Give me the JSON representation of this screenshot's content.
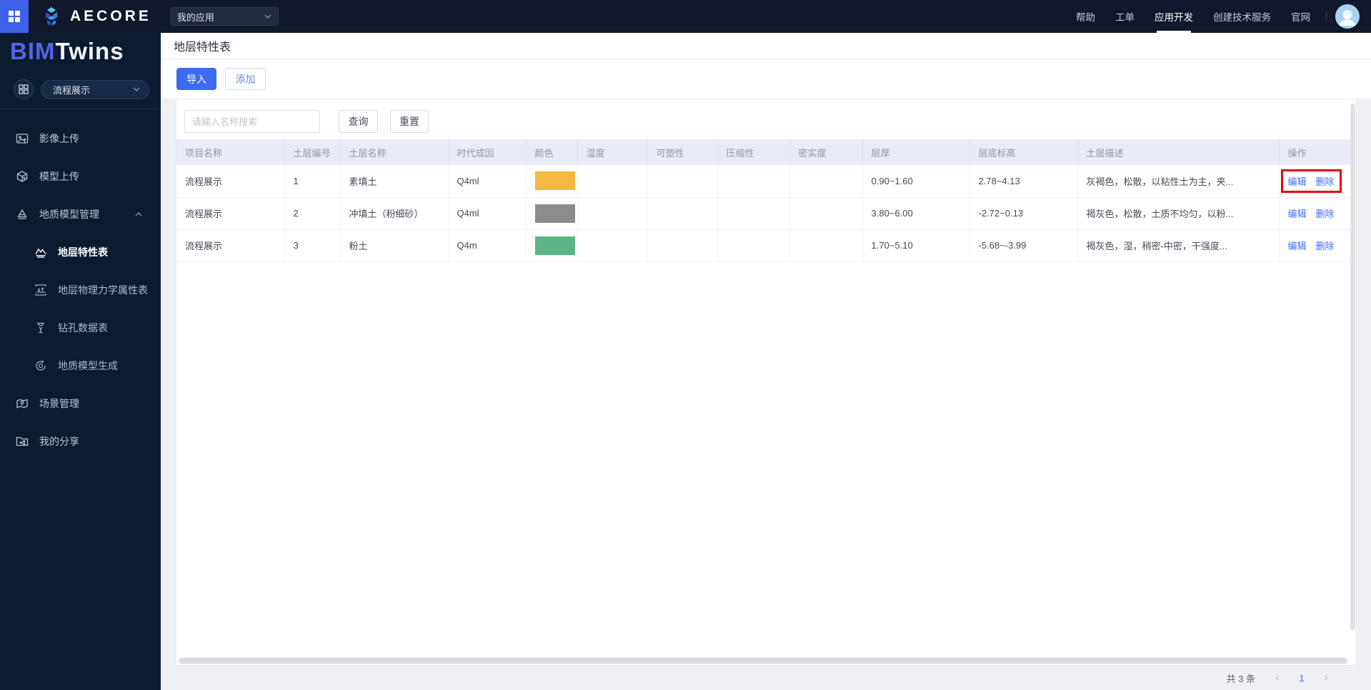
{
  "topbar": {
    "brand": "AECORE",
    "app_select": "我的应用",
    "menu": [
      "帮助",
      "工单",
      "应用开发",
      "创建技术服务",
      "官网"
    ],
    "active_menu": "应用开发"
  },
  "sidebar": {
    "logo_bim": "BIM",
    "logo_twins": "Twins",
    "project_select": "流程展示",
    "items": [
      {
        "label": "影像上传",
        "icon": "image-upload-icon"
      },
      {
        "label": "模型上传",
        "icon": "model-upload-icon"
      },
      {
        "label": "地质模型管理",
        "icon": "geology-model-icon",
        "expanded": true,
        "children": [
          {
            "label": "地层特性表",
            "icon": "strata-chart-icon",
            "active": true
          },
          {
            "label": "地层物理力学属性表",
            "icon": "physics-props-icon"
          },
          {
            "label": "钻孔数据表",
            "icon": "borehole-data-icon"
          },
          {
            "label": "地质模型生成",
            "icon": "model-generate-icon"
          }
        ]
      },
      {
        "label": "场景管理",
        "icon": "scene-manage-icon"
      },
      {
        "label": "我的分享",
        "icon": "my-share-icon"
      }
    ]
  },
  "page": {
    "title": "地层特性表",
    "toolbar": {
      "import": "导入",
      "add": "添加"
    },
    "search": {
      "placeholder": "请输入名称搜索",
      "query": "查询",
      "reset": "重置"
    },
    "table": {
      "columns": [
        "项目名称",
        "土层编号",
        "土层名称",
        "时代成因",
        "颜色",
        "湿度",
        "可塑性",
        "压缩性",
        "密实度",
        "层厚",
        "层底标高",
        "土层描述",
        "操作"
      ],
      "actions": {
        "edit": "编辑",
        "delete": "删除"
      },
      "rows": [
        {
          "project": "流程展示",
          "no": "1",
          "name": "素填土",
          "era": "Q4ml",
          "color": "#f5b840",
          "humidity": "",
          "plasticity": "",
          "compressibility": "",
          "density": "",
          "thickness": "0.90~1.60",
          "elevation": "2.78~4.13",
          "desc": "灰褐色，松散，以粘性土为主，夹...",
          "highlighted": true
        },
        {
          "project": "流程展示",
          "no": "2",
          "name": "冲填土（粉细砂）",
          "era": "Q4ml",
          "color": "#8c8c8c",
          "humidity": "",
          "plasticity": "",
          "compressibility": "",
          "density": "",
          "thickness": "3.80~6.00",
          "elevation": "-2.72~0.13",
          "desc": "褐灰色，松散，土质不均匀，以粉...",
          "highlighted": false
        },
        {
          "project": "流程展示",
          "no": "3",
          "name": "粉土",
          "era": "Q4m",
          "color": "#5cb487",
          "humidity": "",
          "plasticity": "",
          "compressibility": "",
          "density": "",
          "thickness": "1.70~5.10",
          "elevation": "-5.68~-3.99",
          "desc": "褐灰色，湿，稍密-中密，干强度...",
          "highlighted": false
        }
      ]
    },
    "pagination": {
      "total": "共 3 条",
      "prev": "‹",
      "page": "1",
      "next": "›"
    }
  },
  "colors": {
    "primary_blue": "#3e6af0",
    "link_blue": "#3f6cf5",
    "highlight_red": "#e8000d",
    "topbar_bg": "#11182b",
    "sidebar_bg": "#0d1b30",
    "header_row_bg": "#e9ebf6",
    "swatches": [
      "#f5b840",
      "#8c8c8c",
      "#5cb487"
    ]
  }
}
